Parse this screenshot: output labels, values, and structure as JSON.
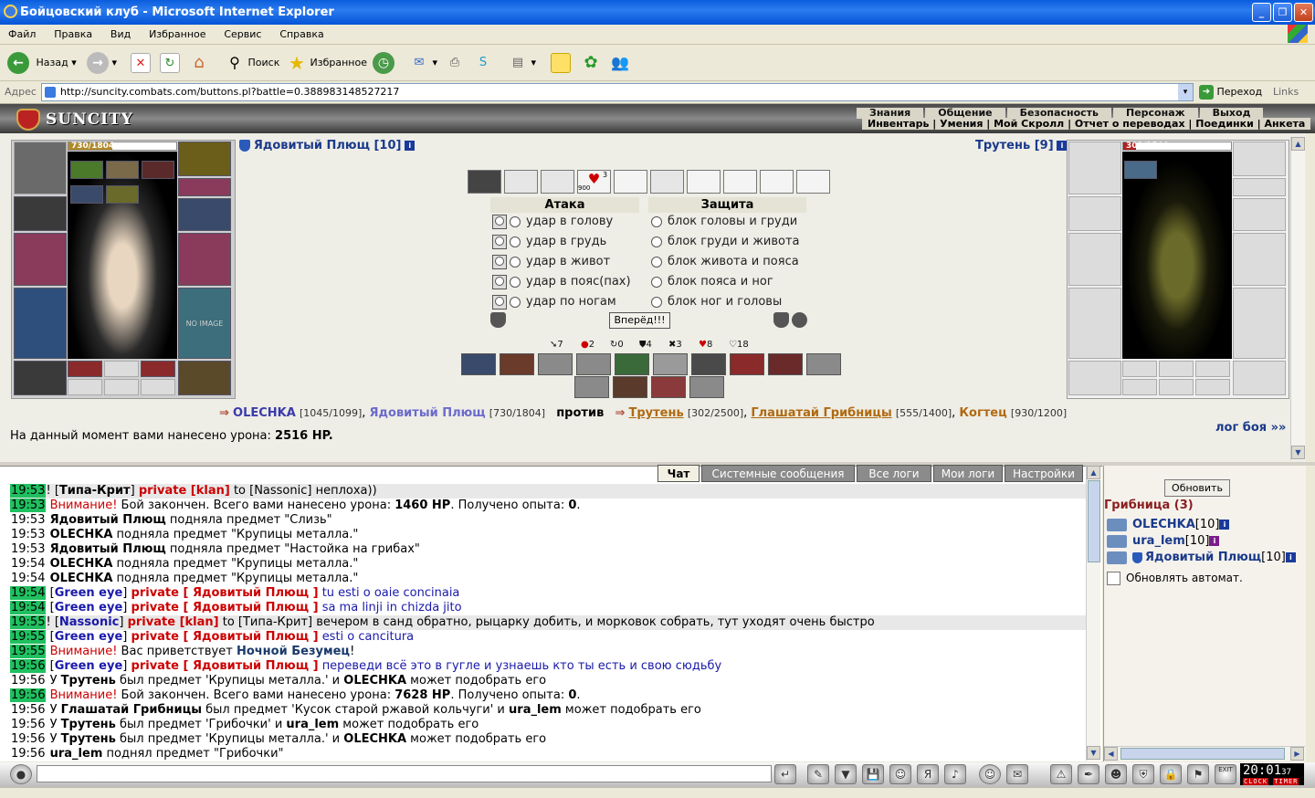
{
  "window": {
    "title": "Бойцовский клуб - Microsoft Internet Explorer",
    "buttons": [
      "_",
      "❐",
      "✕"
    ]
  },
  "menu": [
    "Файл",
    "Правка",
    "Вид",
    "Избранное",
    "Сервис",
    "Справка"
  ],
  "toolbar": {
    "back": "Назад",
    "search": "Поиск",
    "favorites": "Избранное"
  },
  "address": {
    "label": "Адрес",
    "url": "http://suncity.combats.com/buttons.pl?battle=0.388983148527217",
    "go": "Переход",
    "links": "Links"
  },
  "site": {
    "logo": "SUNCITY",
    "nav_top": [
      "Знания",
      "Общение",
      "Безопасность",
      "Персонаж",
      "Выход"
    ],
    "nav_bottom": "Инвентарь | Умения | Мой Скролл | Отчет о переводах | Поединки | Анкета"
  },
  "battle": {
    "left_hp": "730/1804",
    "left_hp_fraction": 0.405,
    "left_name": "Ядовитый Плющ [10]",
    "right_name": "Трутень [9]",
    "right_hp": "302/2500",
    "right_hp_fraction": 0.121,
    "no_image": "NO IMAGE",
    "attack_header": "Атака",
    "defense_header": "Защита",
    "attacks": [
      "удар в голову",
      "удар в грудь",
      "удар в живот",
      "удар в пояс(пах)",
      "удар по ногам"
    ],
    "defenses": [
      "блок головы и груди",
      "блок груди и живота",
      "блок живота и пояса",
      "блок пояса и ног",
      "блок ног и головы"
    ],
    "forward": "Вперёд!!!",
    "tactic_badge": "3",
    "tactic_count": "900",
    "stats": [
      "7",
      "2",
      "0",
      "4",
      "3",
      "8",
      "18"
    ],
    "team1": [
      {
        "name": "OLECHKA",
        "hp": "[1045/1099]"
      },
      {
        "name": "Ядовитый Плющ",
        "hp": "[730/1804]"
      }
    ],
    "vs": "против",
    "team2": [
      {
        "name": "Трутень",
        "hp": "[302/2500]"
      },
      {
        "name": "Глашатай Грибницы",
        "hp": "[555/1400]"
      },
      {
        "name": "Когтец",
        "hp": "[930/1200]"
      }
    ],
    "damage_label": "На данный момент вами нанесено урона:",
    "damage_value": "2516 HP.",
    "log_link": "лог боя »»"
  },
  "chat": {
    "tabs": [
      "Чат",
      "Системные сообщения",
      "Все логи",
      "Мои логи",
      "Настройки"
    ]
  },
  "room": {
    "refresh": "Обновить",
    "title": "Грибница (3)",
    "players": [
      {
        "name": "OLECHKA",
        "level": "[10]"
      },
      {
        "name": "ura_lem",
        "level": "[10]"
      },
      {
        "name": "Ядовитый Плющ",
        "level": "[10]"
      }
    ],
    "auto_update": "Обновлять автомат."
  },
  "clock": {
    "time": "20:01",
    "seconds": "37",
    "label_left": "CLOCK",
    "label_right": "TIMER",
    "exit": "EXIT"
  }
}
